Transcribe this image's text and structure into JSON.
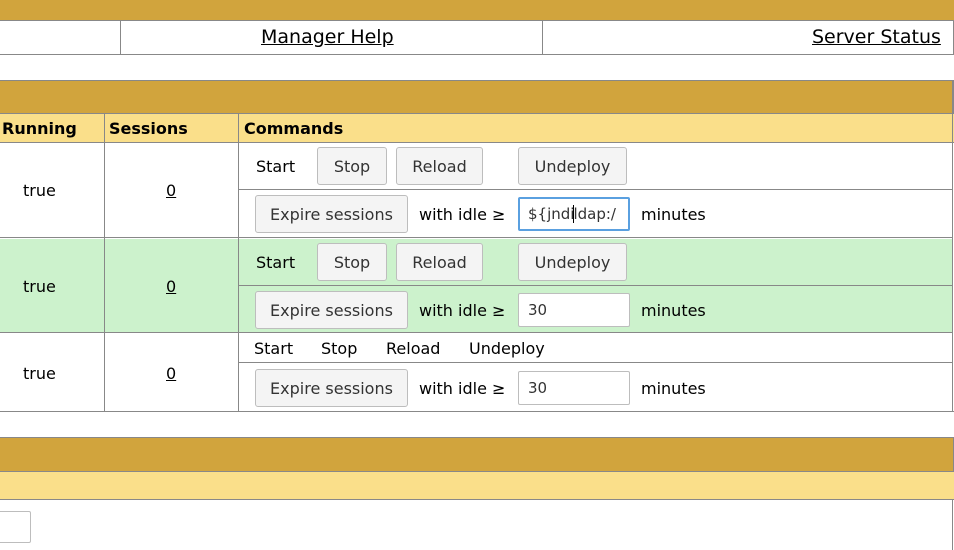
{
  "links": {
    "manager_help": "Manager Help",
    "server_status": "Server Status"
  },
  "table": {
    "headers": {
      "running": "Running",
      "sessions": "Sessions",
      "commands": "Commands"
    },
    "rows": [
      {
        "running": "true",
        "sessions": "0",
        "start": "Start",
        "stop": "Stop",
        "reload": "Reload",
        "undeploy": "Undeploy",
        "expire": "Expire sessions",
        "idle_label": "with idle ≥",
        "idle_value_a": "${jndi",
        "idle_value_b": "ldap:/",
        "minutes": "minutes"
      },
      {
        "running": "true",
        "sessions": "0",
        "start": "Start",
        "stop": "Stop",
        "reload": "Reload",
        "undeploy": "Undeploy",
        "expire": "Expire sessions",
        "idle_label": "with idle ≥",
        "idle_value": "30",
        "minutes": "minutes"
      },
      {
        "running": "true",
        "sessions": "0",
        "start": "Start",
        "stop": "Stop",
        "reload": "Reload",
        "undeploy": "Undeploy",
        "expire": "Expire sessions",
        "idle_label": "with idle ≥",
        "idle_value": "30",
        "minutes": "minutes"
      }
    ]
  },
  "colors": {
    "section_header": "#d1a43d",
    "column_header": "#fadf8a",
    "row_highlight": "#ccf2cc",
    "focus_border": "#5aa0e0"
  }
}
